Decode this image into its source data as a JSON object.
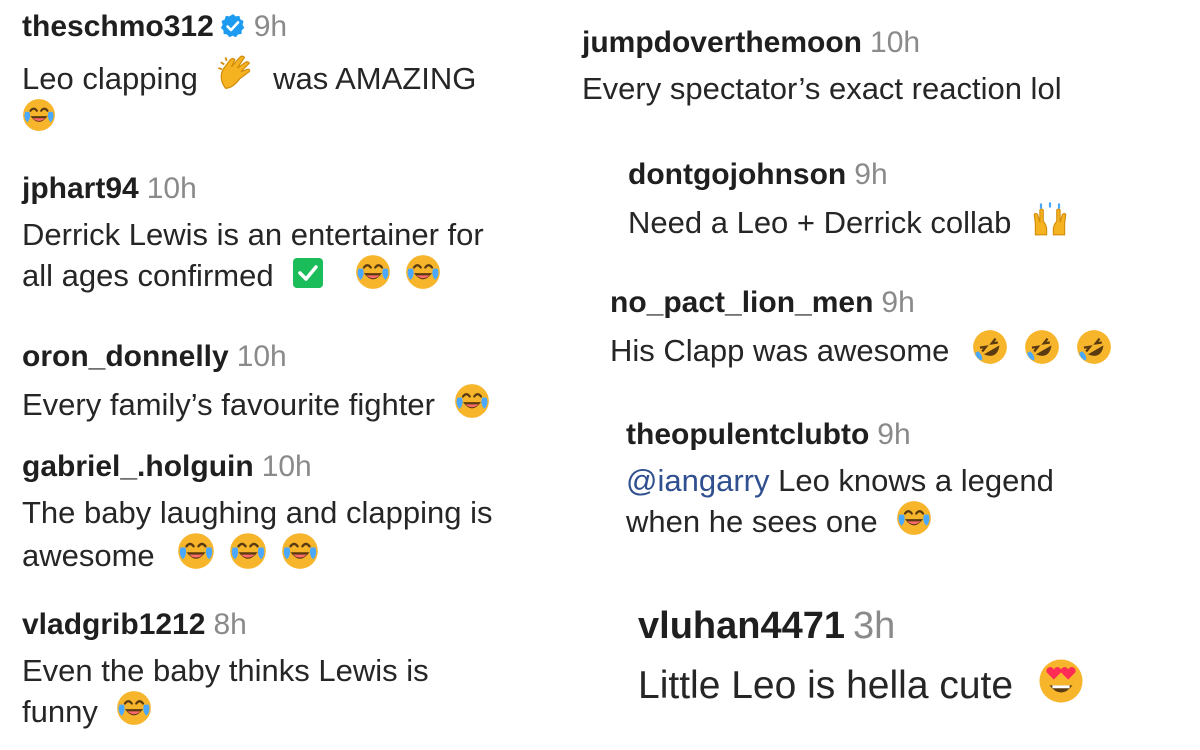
{
  "comments": [
    {
      "username": "theschmo312",
      "time": "9h",
      "verified": true,
      "text1": "Leo clapping",
      "text2": "was AMAZING"
    },
    {
      "username": "jumpdoverthemoon",
      "time": "10h",
      "text": "Every spectator’s exact reaction lol"
    },
    {
      "username": "jphart94",
      "time": "10h",
      "line1": "Derrick Lewis is an entertainer for",
      "line2": "all ages confirmed"
    },
    {
      "username": "dontgojohnson",
      "time": "9h",
      "text": "Need a Leo + Derrick collab"
    },
    {
      "username": "no_pact_lion_men",
      "time": "9h",
      "text": "His Clapp was awesome"
    },
    {
      "username": "oron_donnelly",
      "time": "10h",
      "text": "Every family’s favourite fighter"
    },
    {
      "username": "theopulentclubto",
      "time": "9h",
      "mention": "@iangarry",
      "text1": " Leo knows a legend",
      "line2": "when he sees one"
    },
    {
      "username": "gabriel_.holguin",
      "time": "10h",
      "line1": "The baby laughing and clapping is",
      "line2": "awesome"
    },
    {
      "username": "vladgrib1212",
      "time": "8h",
      "line1": "Even the baby thinks Lewis is",
      "line2": "funny"
    },
    {
      "username": "vluhan4471",
      "time": "3h",
      "text": "Little Leo is hella cute"
    }
  ],
  "emoji_names": {
    "laugh": "face-with-tears-of-joy",
    "rofl": "rolling-on-floor-laughing",
    "clap": "clapping-hands",
    "raised": "raising-hands",
    "hearteyes": "heart-eyes",
    "check": "check-mark-button"
  },
  "colors": {
    "username": "#1f1f1f",
    "time": "#8a8a8a",
    "mention": "#2f4f8f",
    "verified": "#1d9bf0",
    "check": "#1bbc5a",
    "emoji": "#f7b52c"
  }
}
